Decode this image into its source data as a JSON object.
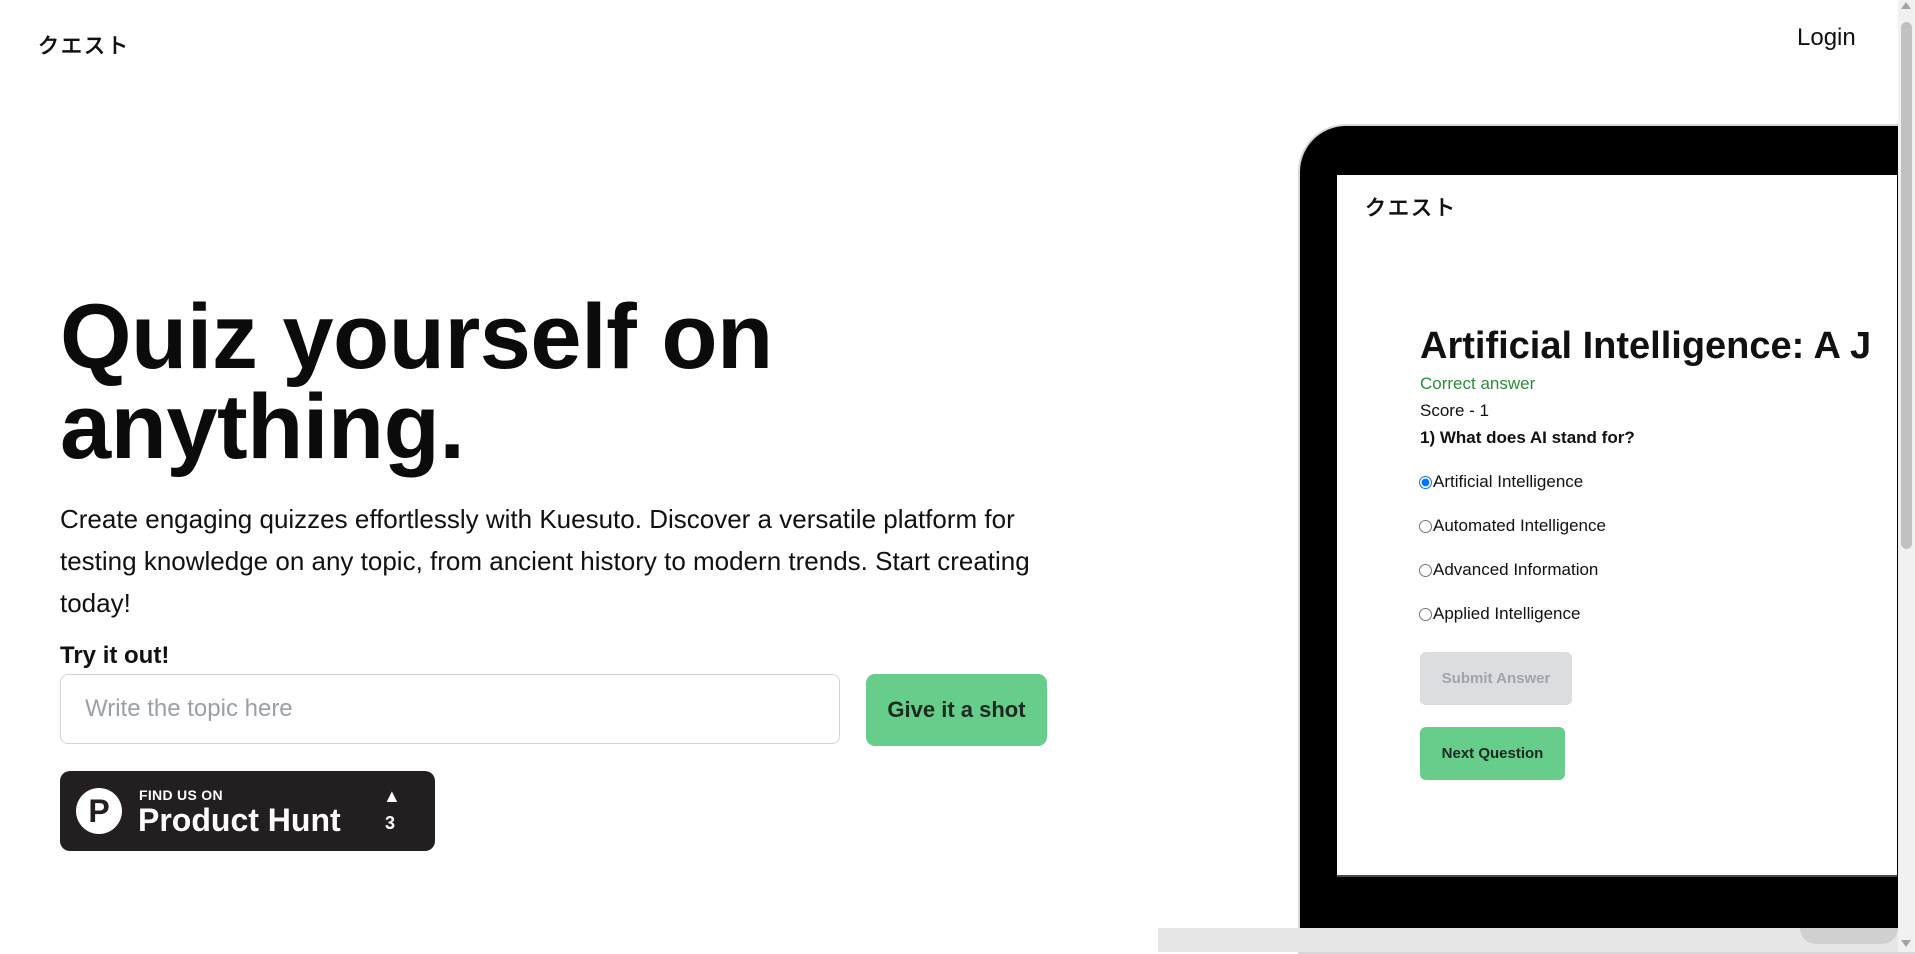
{
  "header": {
    "logo": "クエスト",
    "login_label": "Login"
  },
  "hero": {
    "headline_line1": "Quiz yourself on",
    "headline_line2": "anything.",
    "description": "Create engaging quizzes effortlessly with Kuesuto. Discover a versatile platform for testing knowledge on any topic, from ancient history to modern trends. Start creating today!",
    "try_label": "Try it out!",
    "topic_placeholder": "Write the topic here",
    "topic_value": "",
    "submit_label": "Give it a shot"
  },
  "product_hunt": {
    "find_label": "FIND US ON",
    "name": "Product Hunt",
    "logo_letter": "P",
    "arrow": "▲",
    "upvotes": "3"
  },
  "mockup": {
    "logo": "クエスト",
    "title": "Artificial Intelligence: A J",
    "feedback": "Correct answer",
    "score": "Score - 1",
    "question": "1) What does AI stand for?",
    "options": [
      {
        "label": "Artificial Intelligence",
        "selected": true
      },
      {
        "label": "Automated Intelligence",
        "selected": false
      },
      {
        "label": "Advanced Information",
        "selected": false
      },
      {
        "label": "Applied Intelligence",
        "selected": false
      }
    ],
    "submit_label": "Submit Answer",
    "next_label": "Next Question"
  },
  "colors": {
    "accent_green": "#66cd8a",
    "correct_text": "#2e8b3e",
    "badge_bg": "#231f20"
  }
}
